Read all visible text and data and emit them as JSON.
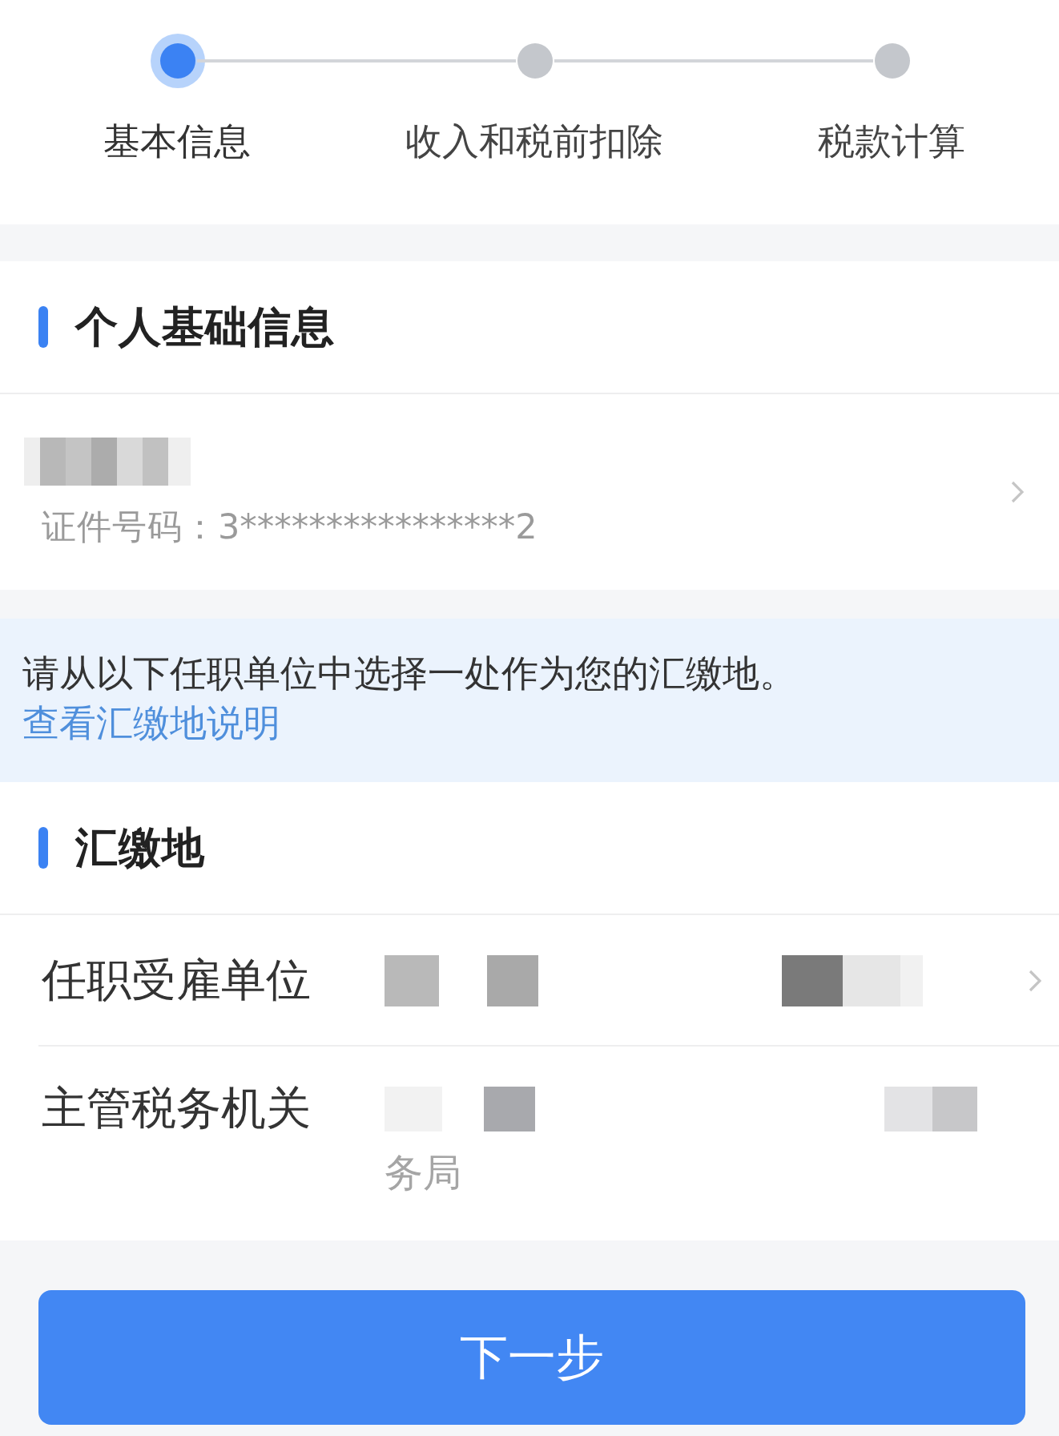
{
  "steps": [
    {
      "label": "基本信息",
      "selected": true
    },
    {
      "label": "收入和税前扣除",
      "selected": false
    },
    {
      "label": "税款计算",
      "selected": false
    }
  ],
  "personal_section": {
    "title": "个人基础信息",
    "name_redacted": true,
    "id_text": "证件号码：3****************2",
    "has_chevron": true
  },
  "notice": {
    "text": "请从以下任职单位中选择一处作为您的汇缴地。",
    "link": "查看汇缴地说明"
  },
  "payment_section": {
    "title": "汇缴地",
    "rows": [
      {
        "label": "任职受雇单位",
        "redacted": true,
        "has_chevron": true
      },
      {
        "label": "主管税务机关",
        "redacted": true,
        "value": "务局",
        "has_chevron": false
      }
    ]
  },
  "next_button": {
    "label": "下一步"
  }
}
